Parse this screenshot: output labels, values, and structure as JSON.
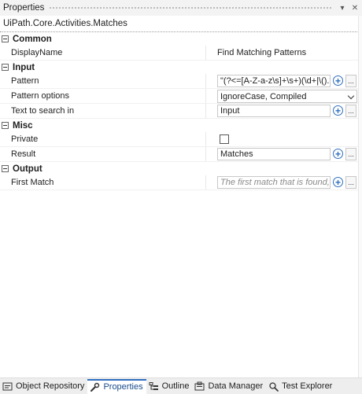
{
  "window": {
    "title": "Properties",
    "pin_glyph": "▾",
    "close_glyph": "✕"
  },
  "activity_name": "UiPath.Core.Activities.Matches",
  "categories": {
    "common": {
      "label": "Common",
      "display_name": {
        "label": "DisplayName",
        "value": "Find Matching Patterns"
      }
    },
    "input": {
      "label": "Input",
      "pattern": {
        "label": "Pattern",
        "value": "\"(?<=[A-Z-a-z\\s]+\\s+)(\\d+|\\().*\""
      },
      "pattern_options": {
        "label": "Pattern options",
        "value": "IgnoreCase, Compiled"
      },
      "text_to_search": {
        "label": "Text to search in",
        "value": "Input"
      }
    },
    "misc": {
      "label": "Misc",
      "private": {
        "label": "Private",
        "checked": false
      },
      "result": {
        "label": "Result",
        "value": "Matches"
      }
    },
    "output": {
      "label": "Output",
      "first_match": {
        "label": "First Match",
        "placeholder": "The first match that is found, as stri..."
      }
    }
  },
  "buttons": {
    "plus": "+",
    "ellipsis": "..."
  },
  "tabs": [
    {
      "label": "Object Repository",
      "icon": "object-repository-icon"
    },
    {
      "label": "Properties",
      "icon": "wrench-icon",
      "active": true
    },
    {
      "label": "Outline",
      "icon": "outline-icon"
    },
    {
      "label": "Data Manager",
      "icon": "data-manager-icon"
    },
    {
      "label": "Test Explorer",
      "icon": "test-explorer-icon"
    }
  ],
  "colors": {
    "accent": "#2f6fbf",
    "active_tab_text": "#1a4b8c"
  }
}
